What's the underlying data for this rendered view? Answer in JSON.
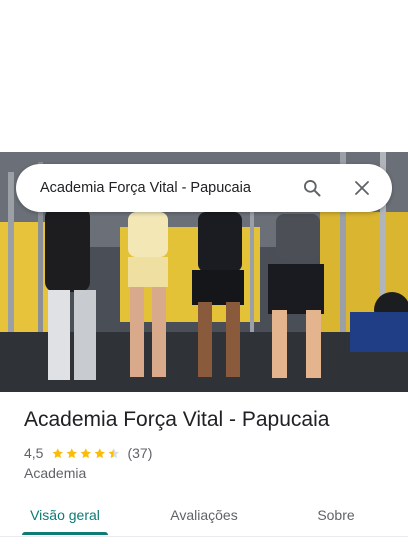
{
  "search": {
    "query": "Academia Força Vital - Papucaia"
  },
  "icons": {
    "search": "search-icon",
    "close": "close-icon",
    "star": "star-icon"
  },
  "place": {
    "name": "Academia Força Vital - Papucaia",
    "rating": "4,5",
    "rating_value": 4.5,
    "stars_max": 5,
    "reviews": "(37)",
    "category": "Academia"
  },
  "tabs": [
    {
      "label": "Visão geral",
      "active": true
    },
    {
      "label": "Avaliações",
      "active": false
    },
    {
      "label": "Sobre",
      "active": false
    }
  ],
  "colors": {
    "accent": "#0d7a73",
    "star": "#fbbc04",
    "text_primary": "#202124",
    "text_secondary": "#5f6368"
  }
}
